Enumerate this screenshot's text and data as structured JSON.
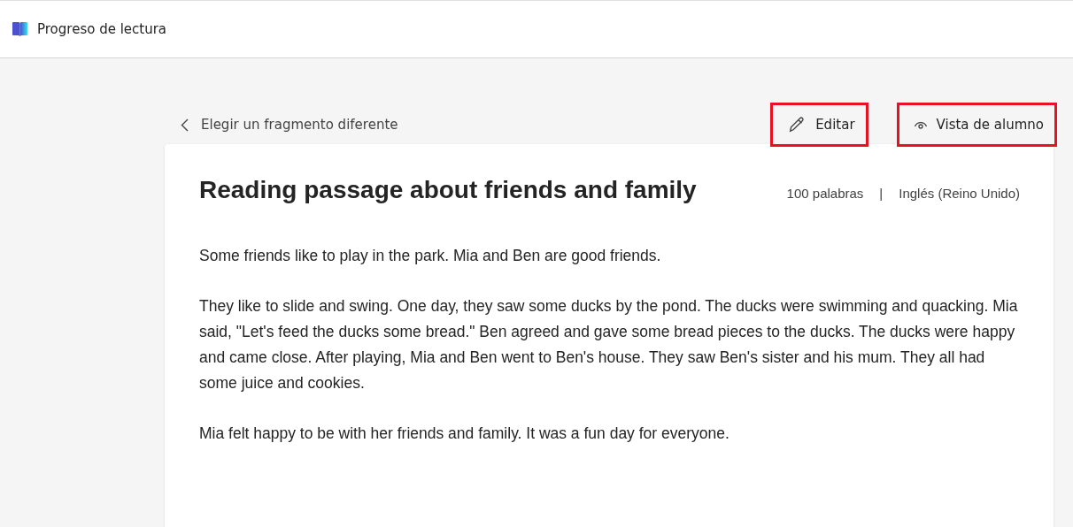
{
  "app": {
    "title": "Progreso de lectura"
  },
  "back_link": {
    "label": "Elegir un fragmento diferente"
  },
  "actions": [
    {
      "kind": "edit",
      "label": "Editar",
      "highlighted": true
    },
    {
      "kind": "preview",
      "label": "Vista de alumno",
      "highlighted": true
    }
  ],
  "passage": {
    "title": "Reading passage about friends and family",
    "word_count": "100 palabras",
    "separator": "|",
    "language": "Inglés (Reino Unido)",
    "paragraphs": [
      "Some friends like to play in the park. Mia and Ben are good friends.",
      "They like to slide and swing. One day, they saw some ducks by the pond. The ducks were swimming and quacking. Mia said, \"Let's feed the ducks some bread.\" Ben agreed and gave some bread pieces to the ducks. The ducks were happy and came close. After playing, Mia and Ben went to Ben's house. They saw Ben's sister and his mum. They all had some juice and cookies.",
      "Mia felt happy to be with her friends and family. It was a fun day for everyone."
    ]
  }
}
